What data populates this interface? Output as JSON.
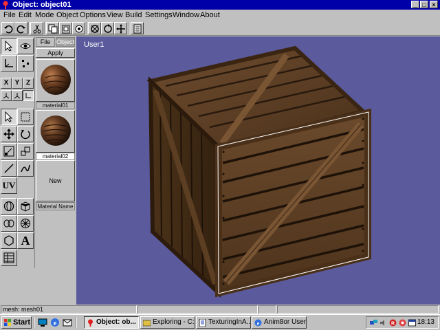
{
  "window": {
    "title": "Object: object01"
  },
  "menu": [
    "File",
    "Edit",
    "Mode",
    "Object",
    "Options",
    "View",
    "Build",
    "Settings",
    "Window",
    "About"
  ],
  "toolbar": {
    "icons": [
      "undo-icon",
      "redo-icon",
      "cut-icon",
      "copy-icon",
      "paste-icon",
      "delete-icon",
      "select-all-icon",
      "rotate-view-icon",
      "move-view-icon",
      "properties-icon"
    ]
  },
  "tools": {
    "axes": [
      "X",
      "Y",
      "Z"
    ],
    "uv_label": "UV",
    "text_label": "A"
  },
  "materials": {
    "tab_file": "File",
    "tab_object": "Object",
    "apply": "Apply",
    "items": [
      {
        "name": "material01"
      },
      {
        "name": "material02"
      }
    ],
    "new_label": "New",
    "name_label": "Material Name"
  },
  "viewport": {
    "label": "User1"
  },
  "status": {
    "text": "mesh: mesh01"
  },
  "taskbar": {
    "start": "Start",
    "tasks": [
      "Object: ob...",
      "Exploring - C:...",
      "TexturingInA...",
      "Anim8or User'..."
    ],
    "clock": "18:13"
  },
  "colors": {
    "title_bar": "#0000a8",
    "viewport_bg": "#5a5a9c",
    "wood_dark": "#3d2a1a",
    "wood_mid": "#6b4a2c",
    "selection": "#ffffff"
  }
}
